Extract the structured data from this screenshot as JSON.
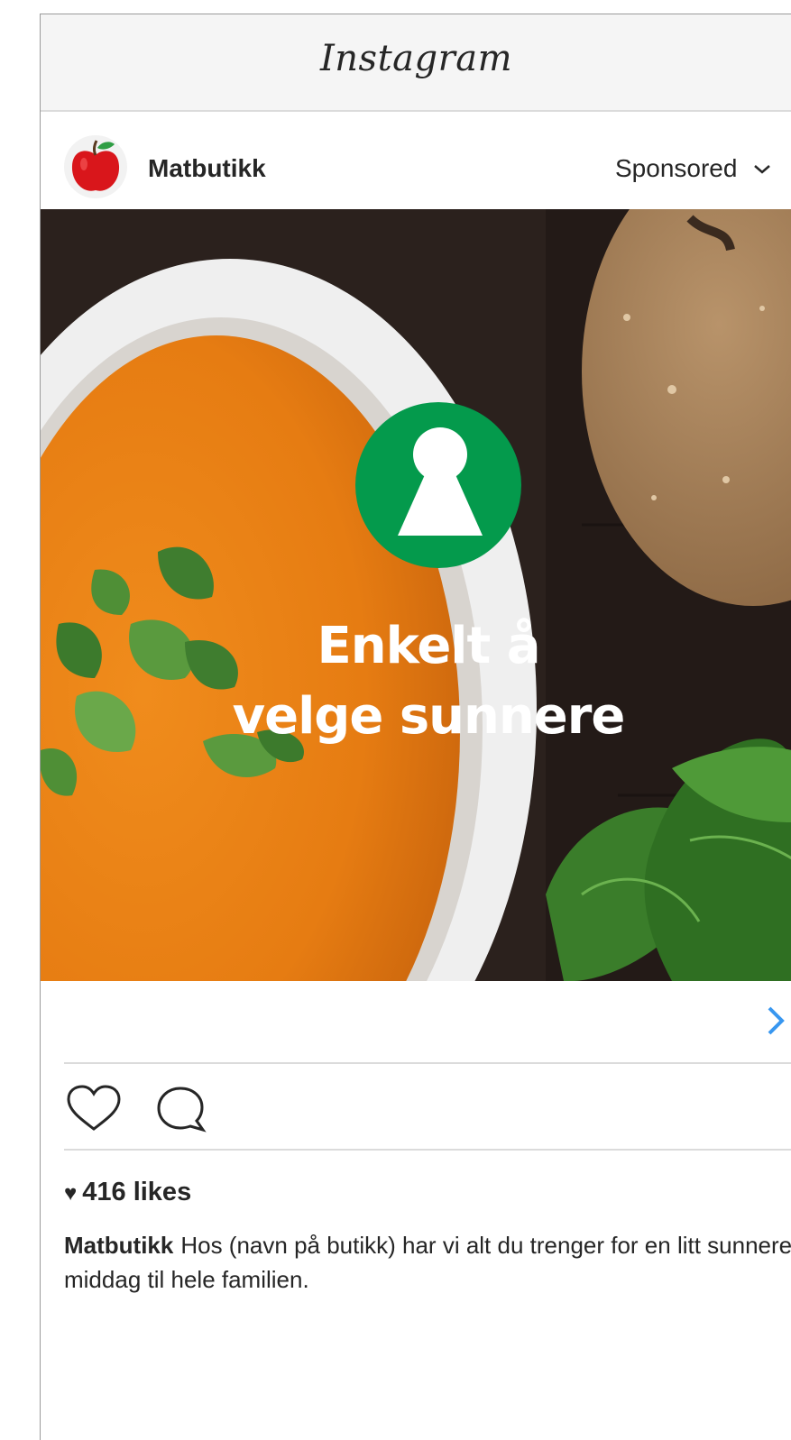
{
  "app": {
    "title": "Instagram"
  },
  "post": {
    "username": "Matbutikk",
    "sponsored_label": "Sponsored",
    "image": {
      "headline_line1": "Enkelt å",
      "headline_line2": "velge sunnere",
      "badge_color": "#049a4c"
    },
    "likes_count": "416 likes",
    "caption_user": "Matbutikk",
    "caption_text": "Hos (navn på butikk) har vi alt du trenger for en litt sunnere middag til hele familien."
  },
  "colors": {
    "accent_link": "#3897f0",
    "divider": "#dbdbdb",
    "text": "#262626"
  },
  "icons": {
    "avatar": "apple-icon",
    "menu": "chevron-down-icon",
    "cta": "chevron-right-icon",
    "like": "heart-icon",
    "comment": "comment-icon",
    "likes_glyph": "heart-filled-icon",
    "badge": "keyhole-icon"
  }
}
